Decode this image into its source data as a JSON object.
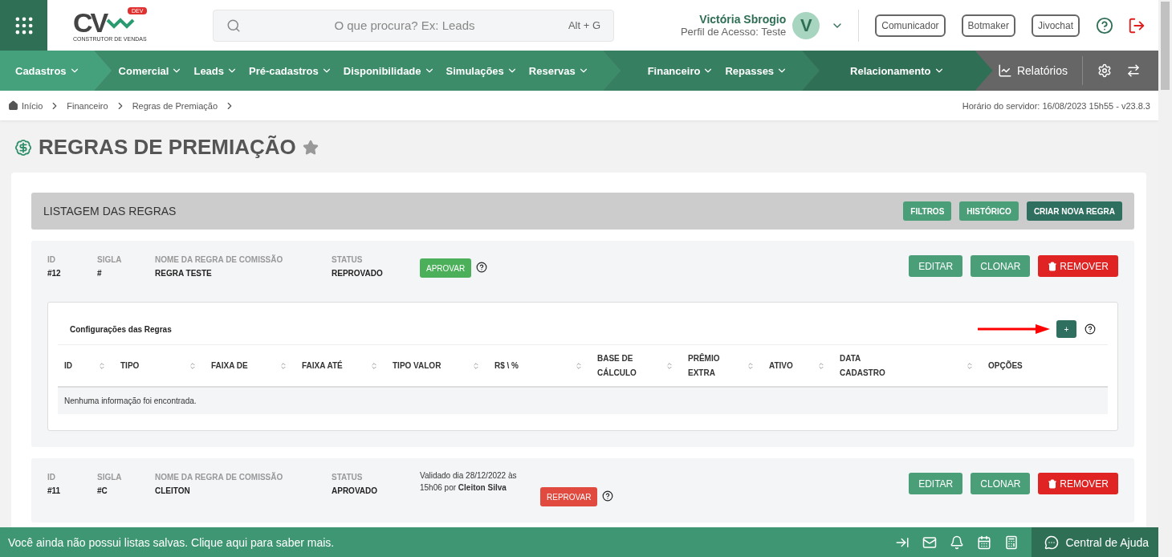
{
  "header": {
    "logo": {
      "text": "CV",
      "badge": "DEV",
      "tagline": "CONSTRUTOR DE VENDAS"
    },
    "search": {
      "placeholder": "O que procura? Ex: Leads",
      "shortcut": "Alt + G"
    },
    "user": {
      "name": "Victória Sbrogio",
      "profile": "Perfil de Acesso: Teste",
      "initial": "V"
    },
    "buttons": [
      "Comunicador",
      "Botmaker",
      "Jivochat"
    ]
  },
  "nav": {
    "groups": [
      {
        "items": [
          "Cadastros"
        ]
      },
      {
        "items": [
          "Comercial",
          "Leads",
          "Pré-cadastros",
          "Disponibilidade",
          "Simulações",
          "Reservas"
        ]
      },
      {
        "items": [
          "Financeiro",
          "Repasses"
        ]
      },
      {
        "items": [
          "Relacionamento"
        ]
      }
    ],
    "reports": "Relatórios"
  },
  "breadcrumb": [
    "Início",
    "Financeiro",
    "Regras de Premiação"
  ],
  "server_time": "Horário do servidor: 16/08/2023 15h55 - v23.8.3",
  "page_title": "REGRAS DE PREMIAÇÃO",
  "favorite": false,
  "list": {
    "title": "LISTAGEM DAS REGRAS",
    "actions": [
      "FILTROS",
      "HISTÓRICO",
      "CRIAR NOVA REGRA"
    ]
  },
  "rules": [
    {
      "fields": [
        {
          "label": "ID",
          "value": "#12"
        },
        {
          "label": "SIGLA",
          "value": "#"
        },
        {
          "label": "NOME DA REGRA DE COMISSÃO",
          "value": "REGRA TESTE"
        },
        {
          "label": "STATUS",
          "value": "REPROVADO"
        }
      ],
      "action": {
        "kind": "approve",
        "label": "APROVAR"
      },
      "buttons": [
        "EDITAR",
        "CLONAR",
        "REMOVER"
      ],
      "config": {
        "title": "Configurações das Regras",
        "add": "+",
        "columns": [
          {
            "label": "ID",
            "sortable": true
          },
          {
            "label": "TIPO",
            "sortable": true
          },
          {
            "label": "FAIXA DE",
            "sortable": true
          },
          {
            "label": "FAIXA ATÉ",
            "sortable": true
          },
          {
            "label": "TIPO VALOR",
            "sortable": true
          },
          {
            "label": "R$ \\ %",
            "sortable": true
          },
          {
            "label": "BASE DE CÁLCULO",
            "sortable": true
          },
          {
            "label": "PRÊMIO EXTRA",
            "sortable": true
          },
          {
            "label": "ATIVO",
            "sortable": true
          },
          {
            "label": "DATA CADASTRO",
            "sortable": true
          },
          {
            "label": "OPÇÕES",
            "sortable": false
          }
        ],
        "empty": "Nenhuma informação foi encontrada."
      }
    },
    {
      "fields": [
        {
          "label": "ID",
          "value": "#11"
        },
        {
          "label": "SIGLA",
          "value": "#C"
        },
        {
          "label": "NOME DA REGRA DE COMISSÃO",
          "value": "CLEITON"
        },
        {
          "label": "STATUS",
          "value": "APROVADO"
        }
      ],
      "validation": "Validado dia 28/12/2022 às 15h06 por **Cleiton Silva**",
      "action": {
        "kind": "reprove",
        "label": "REPROVAR"
      },
      "buttons": [
        "EDITAR",
        "CLONAR",
        "REMOVER"
      ]
    }
  ],
  "footer": {
    "message": "Você ainda não possui listas salvas. Clique aqui para saber mais.",
    "help": "Central de Ajuda"
  }
}
